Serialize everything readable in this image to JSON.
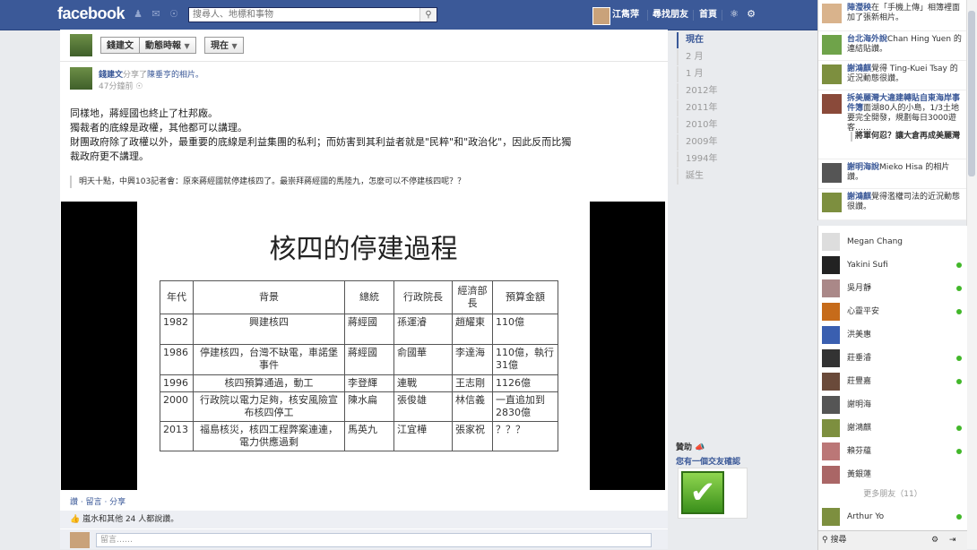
{
  "topbar": {
    "logo": "facebook",
    "search_placeholder": "搜尋人、地標和事物",
    "user_name": "江雋萍",
    "find_friends": "尋找朋友",
    "home": "首頁"
  },
  "header": {
    "name_button": "錢建文",
    "feed_button": "動態時報",
    "now_button": "現在"
  },
  "story": {
    "author": "錢建文",
    "shared_text": "分享了",
    "target_name": "陳垂亨",
    "photo_text": "的相片。",
    "time": "47分鐘前",
    "post_lines": [
      "同樣地，蔣經國也終止了杜邦廠。",
      "獨裁者的底線是政權，其他都可以講理。",
      "財團政府除了政權以外，最重要的底線是利益集團的私利；而妨害到其利益者就是\"民粹\"和\"政治化\"，因此反而比獨",
      "裁政府更不講理。"
    ],
    "quote": "明天十點，中興103記者會：原來蔣經國就停建核四了。最崇拜蔣經國的馬陸九，怎麼可以不停建核四呢？？",
    "actions": "讚 · 留言 · 分享",
    "likes": "嵐水和其他 24 人都說讚。",
    "comment_placeholder": "留言……"
  },
  "slide": {
    "title": "核四的停建過程",
    "headers": [
      "年代",
      "背景",
      "總統",
      "行政院長",
      "經濟部長",
      "預算金額"
    ],
    "rows": [
      [
        "1982",
        "興建核四",
        "蔣經國",
        "孫運濬",
        "趙耀東",
        "110億"
      ],
      [
        "1986",
        "停建核四，台灣不缺電，車諾堡事件",
        "蔣經國",
        "俞國華",
        "李達海",
        "110億，執行31億"
      ],
      [
        "1996",
        "核四預算通過，動工",
        "李登輝",
        "連戰",
        "王志剛",
        "1126億"
      ],
      [
        "2000",
        "行政院以電力足夠，核安風險宣布核四停工",
        "陳水扁",
        "張俊雄",
        "林信義",
        "一直追加到2830億"
      ],
      [
        "2013",
        "福島核災，核四工程弊案連連，電力供應過剩",
        "馬英九",
        "江宜樺",
        "張家祝",
        "？？？"
      ]
    ]
  },
  "timeline": [
    "現在",
    "2 月",
    "1 月",
    "2012年",
    "2011年",
    "2010年",
    "2009年",
    "1994年",
    "誕生"
  ],
  "sponsor": {
    "label": "贊助",
    "link": "您有一個交友確認"
  },
  "ticker": [
    {
      "name": "陣瀅秧",
      "text": "在「手機上傳」相簿裡面加了張新相片。"
    },
    {
      "name": "台北海外說",
      "text": "Chan Hing Yuen 的連結貼讚。"
    },
    {
      "name": "謝鴻麒",
      "text": "覺得 Ting-Kuei Tsay 的近況動態很讚。"
    },
    {
      "name": "拆美麗灣大違建轉貼自東海岸事件簿",
      "text": "面湖80人的小島，1/3土地要完全開發，規劃每日3000遊客……"
    },
    {
      "name": "",
      "text": "將軍何忍？讓大倉再成美麗灣"
    },
    {
      "name": "謝明海說",
      "text": "Mieko Hisa 的相片讚。"
    },
    {
      "name": "謝鴻麒",
      "text": "覺得濫權司法的近況動態很讚。"
    }
  ],
  "chat": {
    "friends": [
      {
        "name": "Megan Chang",
        "online": false
      },
      {
        "name": "Yakini Sufi",
        "online": true
      },
      {
        "name": "吳月靜",
        "online": true
      },
      {
        "name": "心靈平安",
        "online": true
      },
      {
        "name": "洪美惠",
        "online": false
      },
      {
        "name": "莊垂濬",
        "online": true
      },
      {
        "name": "莊豐嘉",
        "online": true
      },
      {
        "name": "謝明海",
        "online": false
      },
      {
        "name": "謝鴻麒",
        "online": true
      },
      {
        "name": "賴芬蘊",
        "online": true
      },
      {
        "name": "黃銀蓮",
        "online": false
      }
    ],
    "more": "更多朋友（11）",
    "last": {
      "name": "Arthur Yo",
      "online": true
    },
    "search_placeholder": "搜尋"
  }
}
